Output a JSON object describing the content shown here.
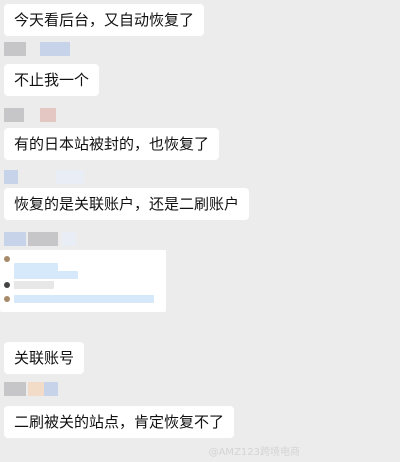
{
  "messages": [
    "今天看后台，又自动恢复了",
    "不止我一个",
    "有的日本站被封的，也恢复了",
    "恢复的是关联账户，还是二刷账户",
    "关联账号",
    "二刷被关的站点，肯定恢复不了"
  ],
  "watermark": "@AMZ123跨境电商"
}
